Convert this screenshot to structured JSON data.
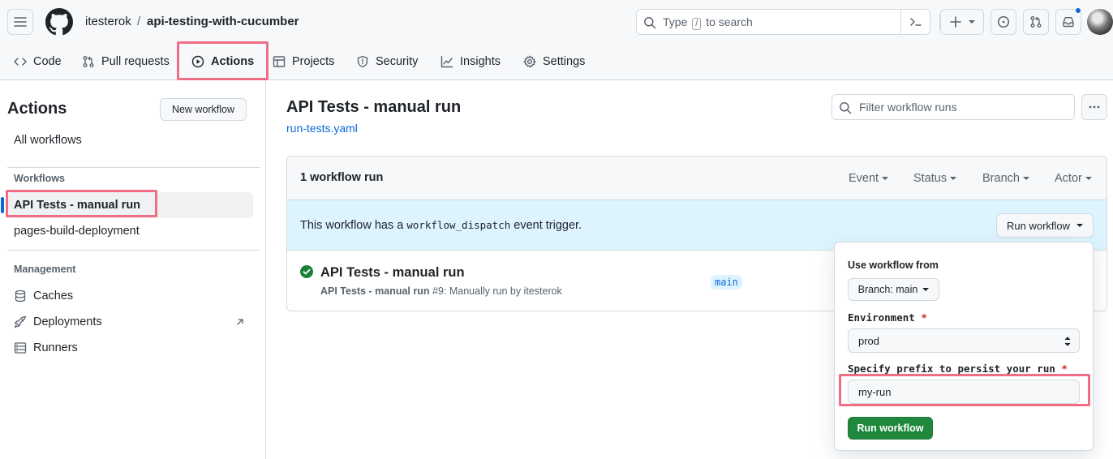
{
  "header": {
    "owner": "itesterok",
    "separator": "/",
    "repo": "api-testing-with-cucumber",
    "search_prefix": "Type",
    "search_key": "/",
    "search_suffix": "to search"
  },
  "tabs": [
    {
      "label": "Code",
      "icon": "code-icon"
    },
    {
      "label": "Pull requests",
      "icon": "git-pull-request-icon"
    },
    {
      "label": "Actions",
      "icon": "play-icon",
      "active": true
    },
    {
      "label": "Projects",
      "icon": "table-icon"
    },
    {
      "label": "Security",
      "icon": "shield-icon"
    },
    {
      "label": "Insights",
      "icon": "graph-icon"
    },
    {
      "label": "Settings",
      "icon": "gear-icon"
    }
  ],
  "sidebar": {
    "title": "Actions",
    "new_workflow": "New workflow",
    "all_workflows": "All workflows",
    "workflows_heading": "Workflows",
    "workflows": [
      "API Tests - manual run",
      "pages-build-deployment"
    ],
    "management_heading": "Management",
    "management": [
      {
        "label": "Caches",
        "icon": "database-icon"
      },
      {
        "label": "Deployments",
        "icon": "rocket-icon"
      },
      {
        "label": "Runners",
        "icon": "server-icon"
      }
    ]
  },
  "main": {
    "title": "API Tests - manual run",
    "file": "run-tests.yaml",
    "filter_placeholder": "Filter workflow runs",
    "run_count": "1 workflow run",
    "filters": [
      "Event",
      "Status",
      "Branch",
      "Actor"
    ],
    "dispatch_text_1": "This workflow has a",
    "dispatch_code": "workflow_dispatch",
    "dispatch_text_2": "event trigger.",
    "run_workflow_button": "Run workflow",
    "run": {
      "title": "API Tests - manual run",
      "meta_name": "API Tests - manual run",
      "meta_rest": "#9: Manually run by itesterok",
      "branch": "main",
      "status_color": "#1a7f37"
    }
  },
  "dropdown": {
    "use_from_label": "Use workflow from",
    "branch_select": "Branch: main",
    "env_label": "Environment",
    "env_value": "prod",
    "prefix_label": "Specify prefix to persist your run",
    "required_mark": "*",
    "prefix_value": "my-run",
    "submit": "Run workflow"
  },
  "colors": {
    "accent": "#0969da",
    "highlight": "#f16d85",
    "success": "#1f883d"
  }
}
